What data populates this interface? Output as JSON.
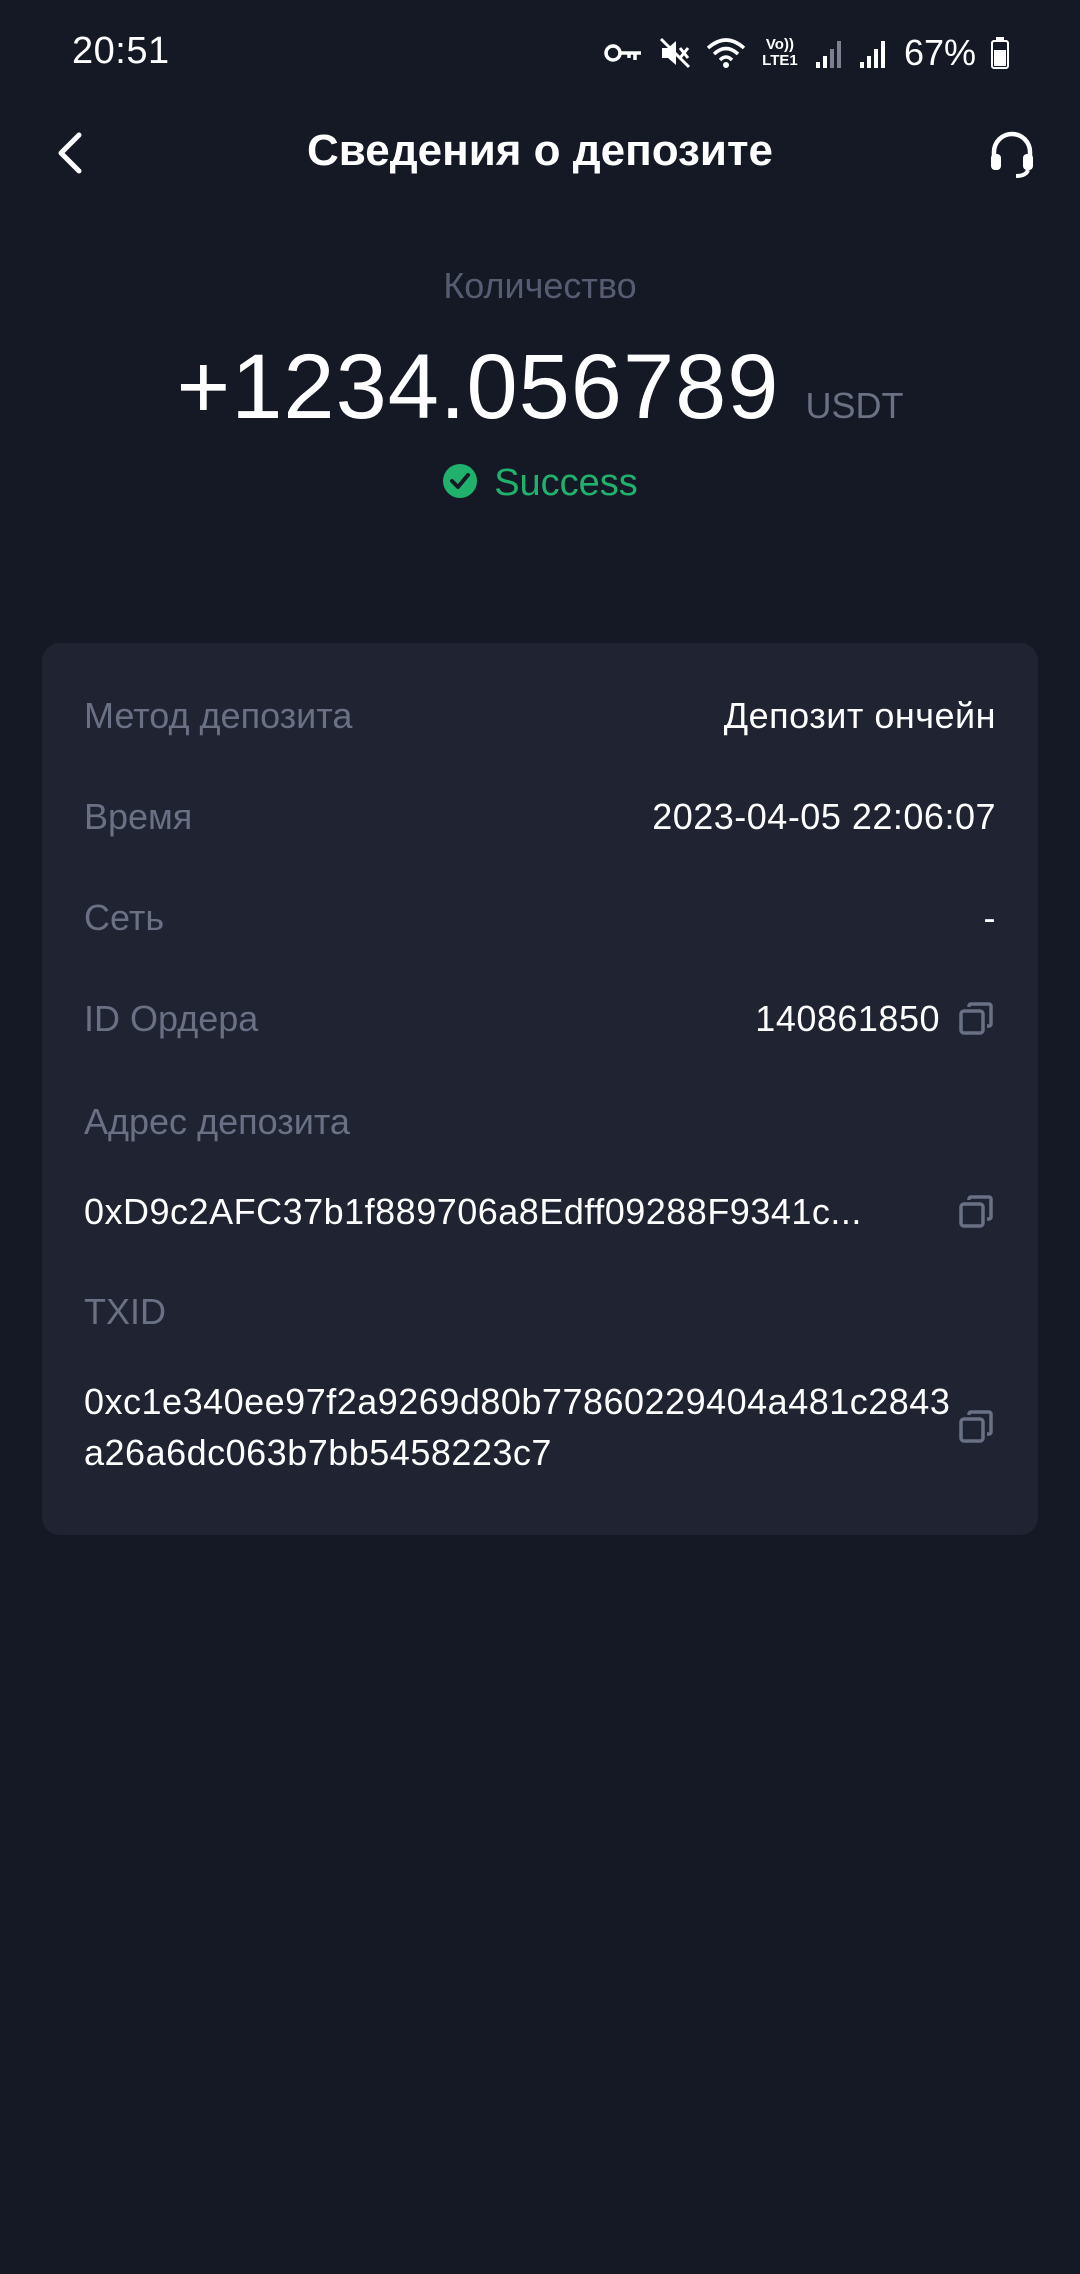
{
  "status_bar": {
    "time": "20:51",
    "network_label_top": "Vo))",
    "network_label_bottom": "LTE1",
    "battery": "67%"
  },
  "header": {
    "title": "Сведения о депозите",
    "back_icon": "chevron-left-icon",
    "support_icon": "headset-icon"
  },
  "summary": {
    "amount_label": "Количество",
    "amount": "+1234.056789",
    "currency": "USDT",
    "status": "Success",
    "status_color": "#20b26c"
  },
  "details": {
    "method_label": "Метод депозита",
    "method_value": "Депозит ончейн",
    "time_label": "Время",
    "time_value": "2023-04-05 22:06:07",
    "network_label": "Сеть",
    "network_value": "-",
    "order_label": "ID Ордера",
    "order_value": "140861850",
    "address_label": "Адрес депозита",
    "address_value": "0xD9c2AFC37b1f889706a8Edff09288F9341c...",
    "txid_label": "TXID",
    "txid_value": "0xc1e340ee97f2a9269d80b77860229404a481c2843a26a6dc063b7bb5458223c7"
  },
  "colors": {
    "background": "#151925",
    "card": "#1f2332",
    "muted_text": "#6a7185",
    "success": "#20b26c"
  }
}
